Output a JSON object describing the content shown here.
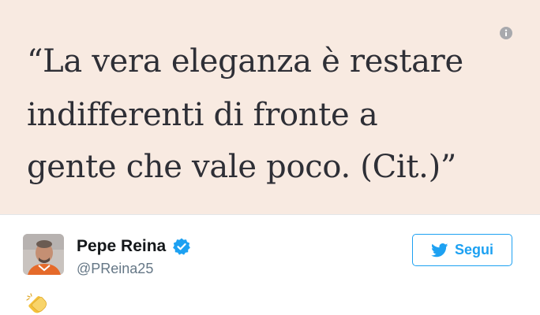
{
  "quote": {
    "lines": [
      "“La vera eleganza è restare",
      "indifferenti di fronte a",
      "gente che vale poco. (Cit.)”"
    ]
  },
  "user": {
    "display_name": "Pepe Reina",
    "handle": "@PReina25",
    "verified": true
  },
  "follow_button": {
    "label": "Segui"
  },
  "tweet": {
    "emoji": "clapping-hands"
  },
  "colors": {
    "quote_background": "#f8eae1",
    "quote_text": "#2e2f36",
    "accent": "#1da1f2",
    "name_text": "#14171a",
    "handle_text": "#657786"
  },
  "icons": {
    "info": "info-icon",
    "verified": "verified-badge-icon",
    "follow": "twitter-bird-icon",
    "emoji": "clapping-hands-emoji"
  }
}
